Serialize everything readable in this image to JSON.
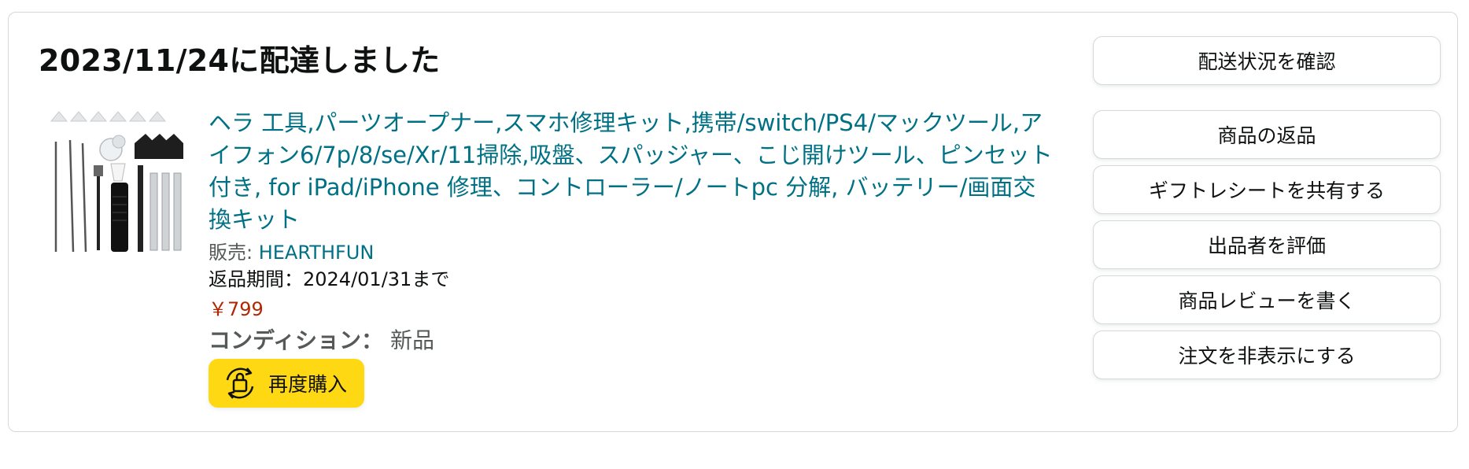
{
  "delivery": {
    "status_title": "2023/11/24に配達しました"
  },
  "product": {
    "title": "ヘラ 工具,パーツオープナー,スマホ修理キット,携帯/switch/PS4/マックツール,アイフォン6/7p/8/se/Xr/11掃除,吸盤、スパッジャー、こじ開けツール、ピンセット付き, for iPad/iPhone 修理、コントローラー/ノートpc 分解, バッテリー/画面交換キット",
    "seller_label": "販売: ",
    "seller_name": "HEARTHFUN",
    "return_period": "返品期間：2024/01/31まで",
    "price": "￥799",
    "condition_label": "コンディション：",
    "condition_value": "新品",
    "buy_again_label": "再度購入",
    "buy_again_icon": "reorder-bag-icon"
  },
  "actions": [
    {
      "label": "配送状況を確認"
    },
    {
      "label": "商品の返品"
    },
    {
      "label": "ギフトレシートを共有する"
    },
    {
      "label": "出品者を評価"
    },
    {
      "label": "商品レビューを書く"
    },
    {
      "label": "注文を非表示にする"
    }
  ],
  "colors": {
    "link": "#007185",
    "price": "#B12704",
    "buy_again_bg": "#FFD814",
    "border": "#D5D9D9"
  }
}
